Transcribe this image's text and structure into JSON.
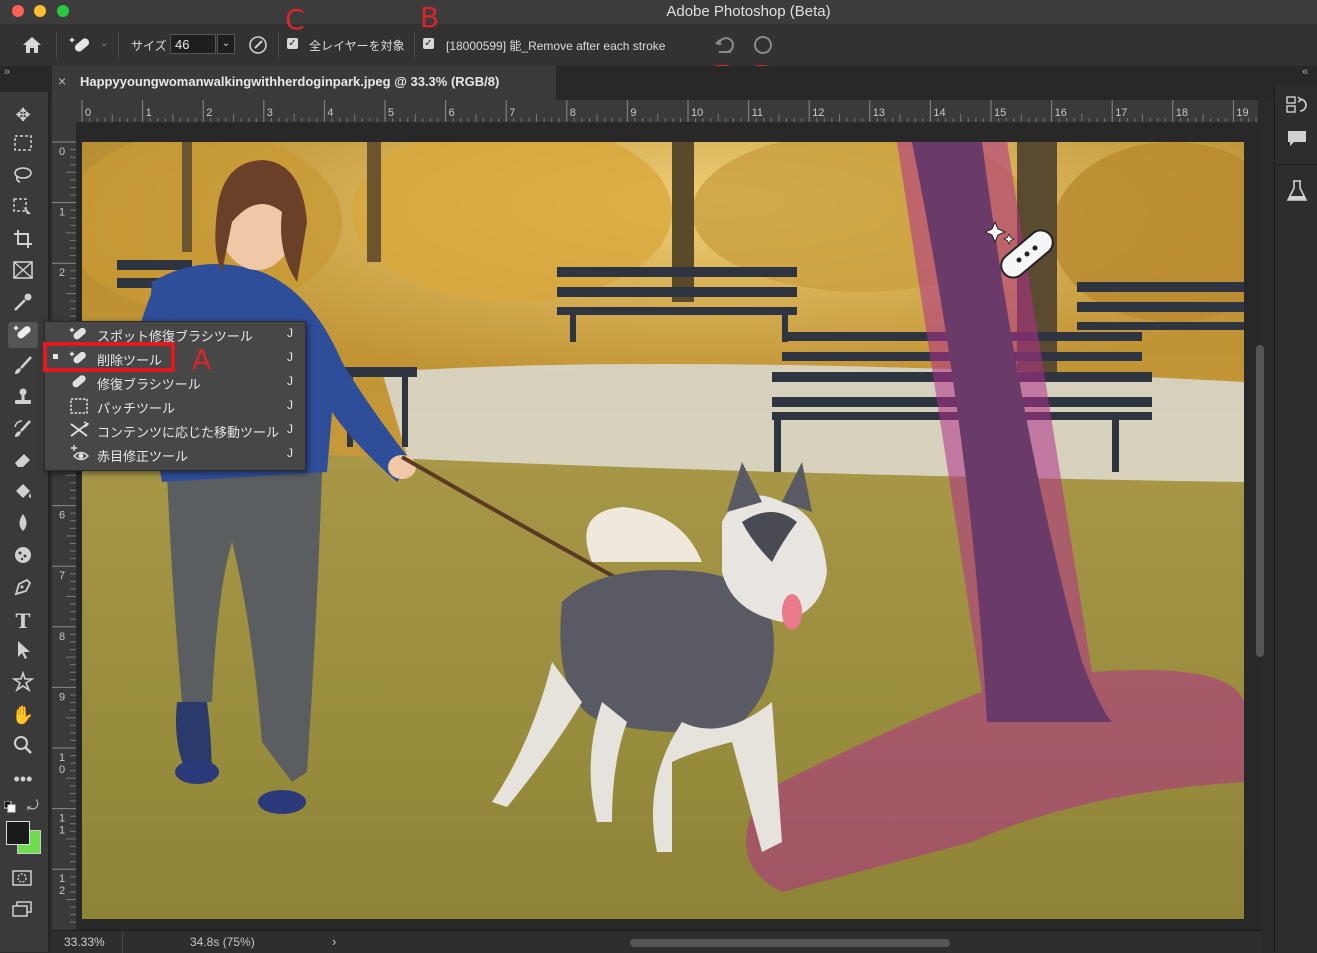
{
  "window": {
    "title": "Adobe Photoshop (Beta)"
  },
  "options_bar": {
    "size_label": "サイズ",
    "size_value": "46",
    "all_layers_label": "全レイヤーを対象",
    "remove_label": "[18000599] 能_Remove after each stroke",
    "annotations": {
      "A": "A",
      "B": "B",
      "C": "C",
      "D": "D",
      "E": "E"
    }
  },
  "document_tab": {
    "title": "Happyyoungwomanwalkingwithherdoginpark.jpeg @ 33.3% (RGB/8)",
    "close": "×"
  },
  "ruler": {
    "h_ticks": [
      "0",
      "1",
      "2",
      "3",
      "4",
      "5",
      "6",
      "7",
      "8",
      "9",
      "10",
      "11",
      "12",
      "13",
      "14",
      "15",
      "16",
      "17",
      "18",
      "19"
    ],
    "v_ticks": [
      "0",
      "1",
      "2",
      "3",
      "4",
      "5",
      "6",
      "7",
      "8",
      "9",
      "1\n0",
      "1\n1",
      "1\n2"
    ]
  },
  "tool_flyout": {
    "items": [
      {
        "label": "スポット修復ブラシツール",
        "shortcut": "J",
        "icon": "spot-healing-icon"
      },
      {
        "label": "削除ツール",
        "shortcut": "J",
        "icon": "remove-tool-icon",
        "selected": true
      },
      {
        "label": "修復ブラシツール",
        "shortcut": "J",
        "icon": "healing-brush-icon"
      },
      {
        "label": "パッチツール",
        "shortcut": "J",
        "icon": "patch-icon"
      },
      {
        "label": "コンテンツに応じた移動ツール",
        "shortcut": "J",
        "icon": "content-aware-move-icon"
      },
      {
        "label": "赤目修正ツール",
        "shortcut": "J",
        "icon": "red-eye-icon"
      }
    ]
  },
  "status_bar": {
    "zoom": "33.33%",
    "info": "34.8s (75%)",
    "arrow": "›"
  },
  "colors": {
    "accent_red": "#d9262a",
    "foreground": "#1b1b1b",
    "background": "#6fdc4f",
    "stroke_overlay": "#b0308a"
  }
}
